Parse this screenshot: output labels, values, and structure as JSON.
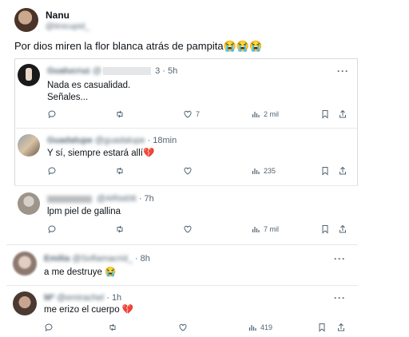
{
  "original": {
    "name": "Nanu",
    "handle": "@tinicupid_",
    "text": "Por dios miren la flor blanca atrás de pampita😭😭😭"
  },
  "replies": [
    {
      "name": "Gualucruz",
      "handle": "@",
      "time": "3 · 5h",
      "lines": [
        "Nada es casualidad.",
        "Señales..."
      ],
      "stats": {
        "reply": "",
        "retweet": "",
        "like": "7",
        "views": "2 mil"
      }
    },
    {
      "name": "Guadalupe",
      "handle": "@guadalupe",
      "time": "· 18min",
      "lines": [
        "Y sí, siempre estará allí💔"
      ],
      "stats": {
        "reply": "",
        "retweet": "",
        "like": "",
        "views": "235"
      }
    },
    {
      "name": "",
      "handle": "@ARist06",
      "time": "· 7h",
      "lines": [
        "lpm piel de gallina"
      ],
      "stats": {
        "reply": "",
        "retweet": "",
        "like": "",
        "views": "7 mil"
      }
    },
    {
      "name": "Emilia",
      "handle": "@Sofiamacrid_",
      "time": "· 8h",
      "lines": [
        "a me destruye 😭"
      ],
      "stats": {
        "reply": "",
        "retweet": "",
        "like": "",
        "views": ""
      }
    },
    {
      "name": "Mª",
      "handle": "@emirachel",
      "time": "· 1h",
      "lines": [
        "me erizo el cuerpo 💔"
      ],
      "stats": {
        "reply": "",
        "retweet": "",
        "like": "",
        "views": "419"
      }
    }
  ],
  "icons": [
    "reply-icon",
    "retweet-icon",
    "like-icon",
    "views-icon",
    "bookmark-icon",
    "share-icon",
    "more-icon"
  ],
  "colors": {
    "text": "#0f1419",
    "muted": "#536471",
    "divider": "#e6e8ea"
  }
}
